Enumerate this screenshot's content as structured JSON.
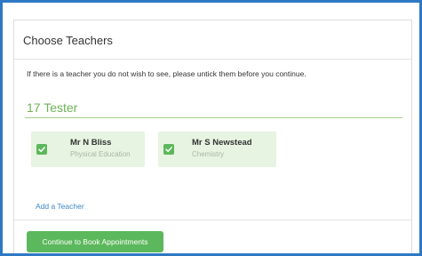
{
  "panel": {
    "title": "Choose Teachers",
    "instructions": "If there is a teacher you do not wish to see, please untick them before you continue."
  },
  "student": {
    "name": "17 Tester"
  },
  "teachers": [
    {
      "name": "Mr N Bliss",
      "subject": "Physical Education",
      "checked": true
    },
    {
      "name": "Mr S Newstead",
      "subject": "Chemistry",
      "checked": true
    }
  ],
  "actions": {
    "add_teacher_label": "Add a Teacher",
    "continue_label": "Continue to Book Appointments"
  },
  "colors": {
    "accent_green": "#5cb85c",
    "card_background": "#e6f4e1",
    "link_blue": "#3a86c8",
    "frame_border": "#2e78c4"
  },
  "icons": {
    "checkbox": "checkmark-icon"
  }
}
